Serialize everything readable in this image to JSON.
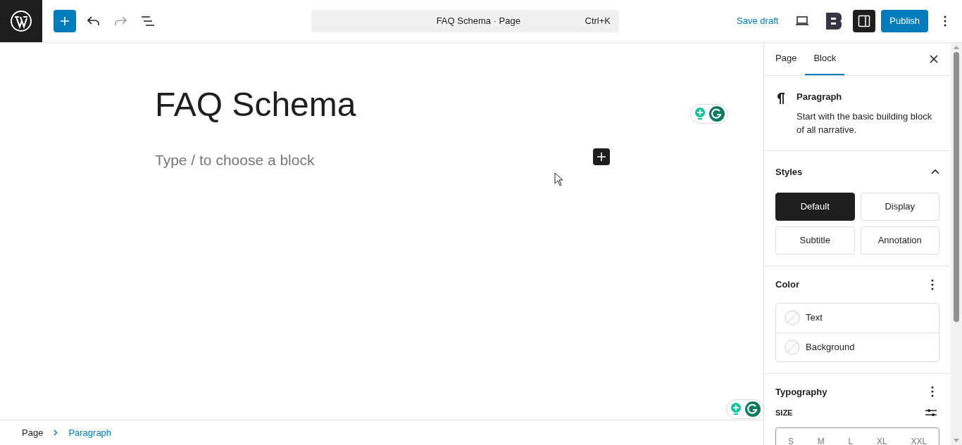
{
  "toolbar": {
    "undo": {
      "disabled": false
    },
    "redo": {
      "disabled": true
    },
    "command": {
      "title": "FAQ Schema · Page",
      "shortcut": "Ctrl+K"
    },
    "save_draft": "Save draft",
    "sidebar_toggle": {
      "active": true
    },
    "publish": "Publish"
  },
  "editor": {
    "title": "FAQ Schema",
    "placeholder": "Type / to choose a block"
  },
  "breadcrumb": [
    {
      "label": "Page",
      "selected": false
    },
    {
      "label": "Paragraph",
      "selected": true
    }
  ],
  "sidebar": {
    "tabs": [
      {
        "label": "Page",
        "selected": false
      },
      {
        "label": "Block",
        "selected": true
      }
    ],
    "block": {
      "name": "Paragraph",
      "description": "Start with the basic building block of all narrative."
    },
    "styles": {
      "title": "Styles",
      "expanded": true,
      "options": [
        {
          "label": "Default",
          "selected": true
        },
        {
          "label": "Display",
          "selected": false
        },
        {
          "label": "Subtitle",
          "selected": false
        },
        {
          "label": "Annotation",
          "selected": false
        }
      ]
    },
    "color": {
      "title": "Color",
      "items": [
        "Text",
        "Background"
      ]
    },
    "typography": {
      "title": "Typography",
      "size_label": "SIZE",
      "sizes": [
        "S",
        "M",
        "L",
        "XL",
        "XXL"
      ]
    }
  }
}
